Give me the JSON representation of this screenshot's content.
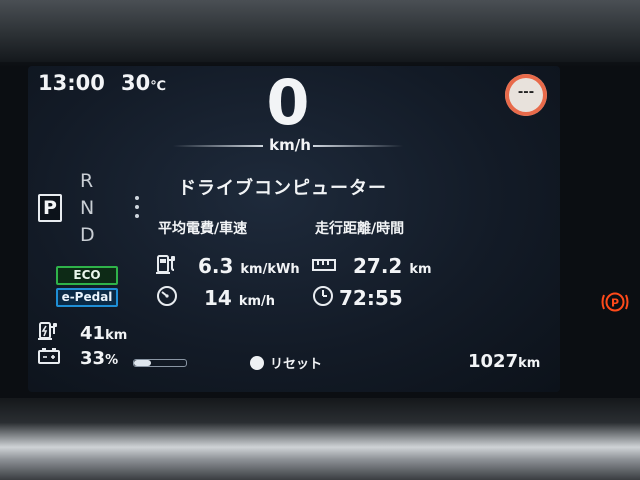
{
  "status": {
    "time": "13:00",
    "temperature": "30",
    "temp_unit": "℃"
  },
  "speed": {
    "value": "0",
    "unit": "km/h"
  },
  "sign": {
    "text": "---"
  },
  "gear": {
    "selected": "P",
    "others": [
      "R",
      "N",
      "D"
    ]
  },
  "modes": {
    "eco": "ECO",
    "epedal": "e-Pedal"
  },
  "drive_computer": {
    "title": "ドライブコンピューター",
    "left_header": "平均電費/車速",
    "right_header": "走行距離/時間",
    "efficiency": {
      "value": "6.3",
      "unit": "km/kWh"
    },
    "avg_speed": {
      "value": "14",
      "unit": "km/h"
    },
    "distance": {
      "value": "27.2",
      "unit": "km"
    },
    "time": {
      "value": "72:55"
    }
  },
  "range": {
    "value": "41",
    "unit": "km"
  },
  "battery": {
    "value": "33",
    "unit": "%",
    "level": 0.33
  },
  "reset": {
    "label": "リセット"
  },
  "odometer": {
    "value": "1027",
    "unit": "km"
  },
  "colors": {
    "eco_green": "#2fb34a",
    "epedal_blue": "#1f8fd6",
    "warning": "#ff4a1a"
  }
}
